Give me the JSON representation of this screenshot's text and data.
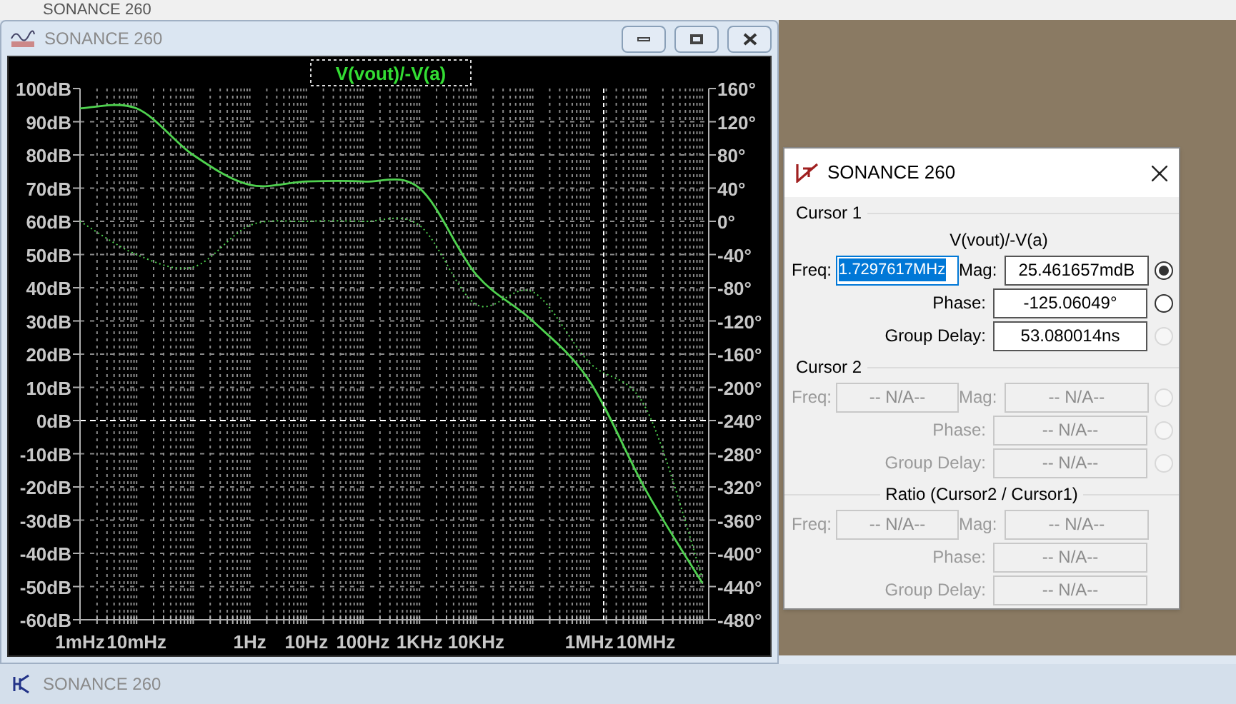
{
  "top_tab": {
    "title": "SONANCE 260"
  },
  "plot_window": {
    "title": "SONANCE 260",
    "trace_label": "V(vout)/-V(a)",
    "chart_data": {
      "type": "line",
      "categories": [
        "1mHz",
        "10mHz",
        null,
        "1Hz",
        "10Hz",
        "100Hz",
        "1KHz",
        "10KHz",
        null,
        "1MHz",
        "10MHz",
        null
      ],
      "series": [
        {
          "color": "#4fd24f",
          "line_style": "solid",
          "values": [
            94,
            94,
            80,
            71,
            72,
            72,
            70,
            44,
            30,
            12,
            -21,
            -49
          ]
        },
        {
          "color": "#4fd24f",
          "axis": "y2",
          "line_style": "dotted",
          "values": [
            0,
            -40,
            -55,
            -5,
            0,
            0,
            -5,
            -100,
            -85,
            -170,
            -225,
            -430
          ]
        }
      ],
      "ylim": [
        -60,
        100
      ],
      "y2lim": [
        -480,
        160
      ],
      "grid": true,
      "ref_lines": [
        {
          "axis": "y",
          "value": 0,
          "color": "#ffffff"
        }
      ],
      "yticks": [
        {
          "value": 100,
          "label": "100dB"
        },
        {
          "value": 90,
          "label": "90dB"
        },
        {
          "value": 80,
          "label": "80dB"
        },
        {
          "value": 70,
          "label": "70dB"
        },
        {
          "value": 60,
          "label": "60dB"
        },
        {
          "value": 50,
          "label": "50dB"
        },
        {
          "value": 40,
          "label": "40dB"
        },
        {
          "value": 30,
          "label": "30dB"
        },
        {
          "value": 20,
          "label": "20dB"
        },
        {
          "value": 10,
          "label": "10dB"
        },
        {
          "value": 0,
          "label": "0dB"
        },
        {
          "value": -10,
          "label": "-10dB"
        },
        {
          "value": -20,
          "label": "-20dB"
        },
        {
          "value": -30,
          "label": "-30dB"
        },
        {
          "value": -40,
          "label": "-40dB"
        },
        {
          "value": -50,
          "label": "-50dB"
        },
        {
          "value": -60,
          "label": "-60dB"
        }
      ],
      "y2ticks": [
        {
          "value": 160,
          "label": "160°"
        },
        {
          "value": 120,
          "label": "120°"
        },
        {
          "value": 80,
          "label": "80°"
        },
        {
          "value": 40,
          "label": "40°"
        },
        {
          "value": 0,
          "label": "0°"
        },
        {
          "value": -40,
          "label": "-40°"
        },
        {
          "value": -80,
          "label": "-80°"
        },
        {
          "value": -120,
          "label": "-120°"
        },
        {
          "value": -160,
          "label": "-160°"
        },
        {
          "value": -200,
          "label": "-200°"
        },
        {
          "value": -240,
          "label": "-240°"
        },
        {
          "value": -280,
          "label": "-280°"
        },
        {
          "value": -320,
          "label": "-320°"
        },
        {
          "value": -360,
          "label": "-360°"
        },
        {
          "value": -400,
          "label": "-400°"
        },
        {
          "value": -440,
          "label": "-440°"
        },
        {
          "value": -480,
          "label": "-480°"
        }
      ]
    }
  },
  "cursor_dialog": {
    "title": "SONANCE 260",
    "sections": [
      {
        "heading": "Cursor 1",
        "kind": "cursor",
        "trace": "V(vout)/-V(a)",
        "freq": {
          "label": "Freq:",
          "value": "1.7297617MHz",
          "highlighted": true,
          "disabled": false
        },
        "rows": [
          {
            "label": "Mag:",
            "value": "25.461657mdB",
            "selected": true,
            "disabled": false,
            "radio_disabled": false
          },
          {
            "label": "Phase:",
            "value": "-125.06049°",
            "selected": false,
            "disabled": false,
            "radio_disabled": false
          },
          {
            "label": "Group Delay:",
            "value": "53.080014ns",
            "selected": false,
            "disabled": false,
            "radio_disabled": true
          }
        ]
      },
      {
        "heading": "Cursor 2",
        "kind": "cursor",
        "freq": {
          "label": "Freq:",
          "value": "-- N/A--",
          "highlighted": false,
          "disabled": true
        },
        "rows": [
          {
            "label": "Mag:",
            "value": "-- N/A--",
            "selected": false,
            "disabled": true,
            "radio_disabled": true
          },
          {
            "label": "Phase:",
            "value": "-- N/A--",
            "selected": false,
            "disabled": true,
            "radio_disabled": true
          },
          {
            "label": "Group Delay:",
            "value": "-- N/A--",
            "selected": false,
            "disabled": true,
            "radio_disabled": true
          }
        ]
      },
      {
        "heading": "Ratio (Cursor2 / Cursor1)",
        "kind": "ratio",
        "freq": {
          "label": "Freq:",
          "value": "-- N/A--",
          "highlighted": false,
          "disabled": true
        },
        "rows": [
          {
            "label": "Mag:",
            "value": "-- N/A--",
            "disabled": true
          },
          {
            "label": "Phase:",
            "value": "-- N/A--",
            "disabled": true
          },
          {
            "label": "Group Delay:",
            "value": "-- N/A--",
            "disabled": true
          }
        ]
      }
    ]
  },
  "bottom_bar": {
    "title": "SONANCE 260"
  }
}
